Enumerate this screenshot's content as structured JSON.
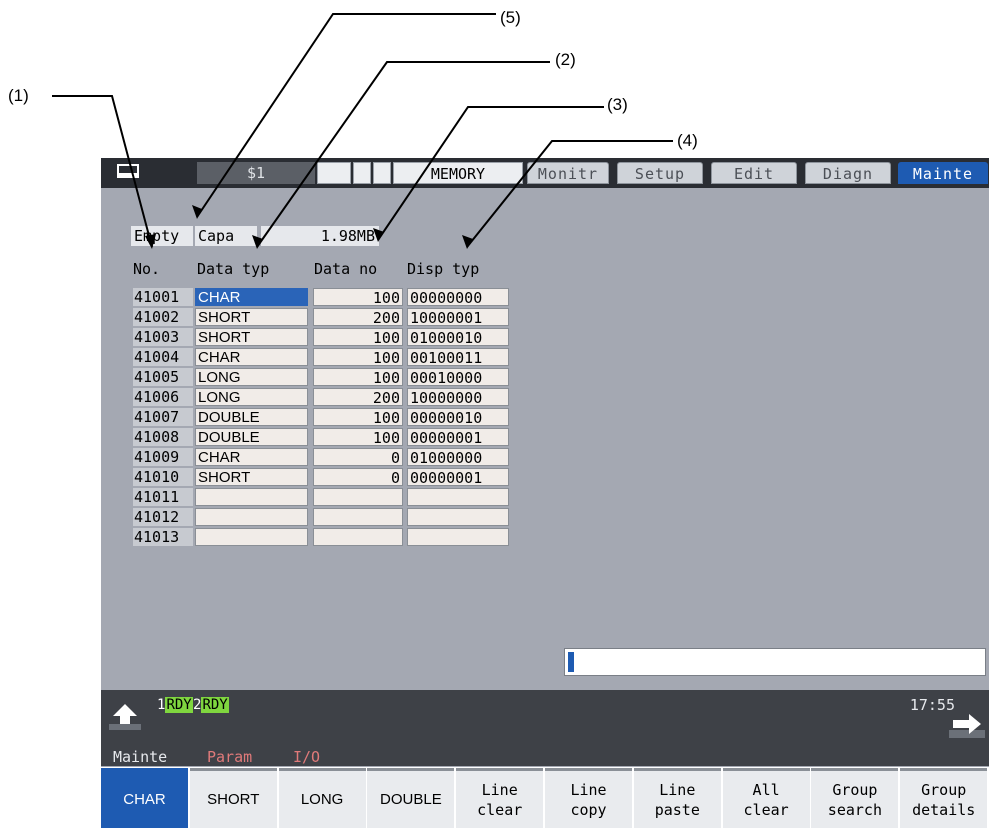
{
  "callouts": {
    "c1": "(1)",
    "c2": "(2)",
    "c3": "(3)",
    "c4": "(4)",
    "c5": "(5)"
  },
  "topbar": {
    "window_icon": "window-icon",
    "system": "$1",
    "mode": "MEMORY",
    "tabs": [
      {
        "label": "Monitr",
        "active": false
      },
      {
        "label": "Setup",
        "active": false
      },
      {
        "label": "Edit",
        "active": false
      },
      {
        "label": "Diagn",
        "active": false
      },
      {
        "label": "Mainte",
        "active": true
      }
    ]
  },
  "capacity": {
    "label1": "Empty",
    "label2": "Capa",
    "value": "1.98MB"
  },
  "table": {
    "headers": {
      "no": "No.",
      "data_type": "Data typ",
      "data_no": "Data no",
      "disp_type": "Disp typ"
    },
    "rows": [
      {
        "no": "41001",
        "type": "CHAR",
        "data_no": "100",
        "disp": "00000000"
      },
      {
        "no": "41002",
        "type": "SHORT",
        "data_no": "200",
        "disp": "10000001"
      },
      {
        "no": "41003",
        "type": "SHORT",
        "data_no": "100",
        "disp": "01000010"
      },
      {
        "no": "41004",
        "type": "CHAR",
        "data_no": "100",
        "disp": "00100011"
      },
      {
        "no": "41005",
        "type": "LONG",
        "data_no": "100",
        "disp": "00010000"
      },
      {
        "no": "41006",
        "type": "LONG",
        "data_no": "200",
        "disp": "10000000"
      },
      {
        "no": "41007",
        "type": "DOUBLE",
        "data_no": "100",
        "disp": "00000010"
      },
      {
        "no": "41008",
        "type": "DOUBLE",
        "data_no": "100",
        "disp": "00000001"
      },
      {
        "no": "41009",
        "type": "CHAR",
        "data_no": "0",
        "disp": "01000000"
      },
      {
        "no": "41010",
        "type": "SHORT",
        "data_no": "0",
        "disp": "00000001"
      },
      {
        "no": "41011",
        "type": "",
        "data_no": "",
        "disp": ""
      },
      {
        "no": "41012",
        "type": "",
        "data_no": "",
        "disp": ""
      },
      {
        "no": "41013",
        "type": "",
        "data_no": "",
        "disp": ""
      }
    ],
    "selected_row": 0
  },
  "progress": {
    "fraction": 0.01
  },
  "status": {
    "ch1_num": "1",
    "ch1_rdy": "RDY",
    "ch2_num": "2",
    "ch2_rdy": "RDY",
    "time": "17:55",
    "back_icon": "return-arrow-icon",
    "forward_icon": "forward-arrow-icon",
    "menu_path": [
      {
        "label": "Mainte",
        "color": "#e6e8ec"
      },
      {
        "label": "Param",
        "color": "#e07a7a"
      },
      {
        "label": "I/O",
        "color": "#e07a7a"
      }
    ]
  },
  "softkeys": [
    {
      "label": "CHAR",
      "active": true
    },
    {
      "label": "SHORT",
      "active": false
    },
    {
      "label": "LONG",
      "active": false
    },
    {
      "label": "DOUBLE",
      "active": false
    },
    {
      "label": "Line\nclear",
      "active": false
    },
    {
      "label": "Line\ncopy",
      "active": false
    },
    {
      "label": "Line\npaste",
      "active": false
    },
    {
      "label": "All\nclear",
      "active": false
    },
    {
      "label": "Group\nsearch",
      "active": false
    },
    {
      "label": "Group\ndetails",
      "active": false
    }
  ],
  "colors": {
    "accent": "#1e5bb2",
    "screen_bg": "#a4a8b2",
    "rdy_green": "#7fd63f"
  }
}
